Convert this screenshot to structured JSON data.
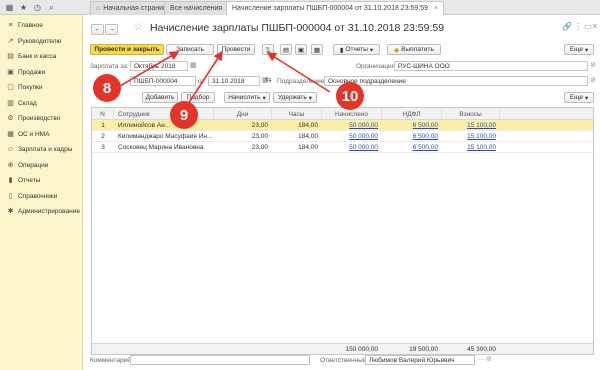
{
  "topbar": {
    "tabs": [
      {
        "label": "Начальная страница"
      },
      {
        "label": "Все начисления"
      },
      {
        "label": "Начисление зарплаты ПШБП-000004 от 31.10.2018 23:59:59"
      }
    ],
    "close_glyph": "×"
  },
  "sidebar": {
    "items": [
      {
        "label": "Главное",
        "icon": "home-icon"
      },
      {
        "label": "Руководителю",
        "icon": "chart-icon"
      },
      {
        "label": "Банк и касса",
        "icon": "bank-icon"
      },
      {
        "label": "Продажи",
        "icon": "sales-icon"
      },
      {
        "label": "Покупки",
        "icon": "cart-icon"
      },
      {
        "label": "Склад",
        "icon": "warehouse-icon"
      },
      {
        "label": "Производство",
        "icon": "factory-icon"
      },
      {
        "label": "ОС и НМА",
        "icon": "assets-icon"
      },
      {
        "label": "Зарплата и кадры",
        "icon": "people-icon"
      },
      {
        "label": "Операции",
        "icon": "operations-icon"
      },
      {
        "label": "Отчеты",
        "icon": "reports-icon"
      },
      {
        "label": "Справочники",
        "icon": "books-icon"
      },
      {
        "label": "Администрирование",
        "icon": "gear-icon"
      }
    ]
  },
  "document": {
    "title": "Начисление зарплаты ПШБП-000004 от 31.10.2018 23:59:59",
    "toolbar": {
      "post_close": "Провести и закрыть",
      "save": "Записать",
      "post": "Провести",
      "reports": "Отчеты",
      "pay": "Выплатить",
      "more": "Еще"
    },
    "fields": {
      "month_label": "Зарплата за:",
      "month_value": "Октябрь 2018",
      "number_value": "ПШБП-000004",
      "date_label": "от:",
      "date_value": "31.10.2018",
      "org_label": "Организация:",
      "org_value": "РУС-ШИНА ООО",
      "dept_label": "Подразделение:",
      "dept_value": "Основное подразделение"
    },
    "table_toolbar": {
      "add": "Добавить",
      "select": "Подбор",
      "accrue": "Начислить",
      "withhold": "Удержать",
      "more": "Еще"
    },
    "table": {
      "columns": [
        "N",
        "Сотрудник",
        "Дни",
        "Часы",
        "Начислено",
        "НДФЛ",
        "Взносы"
      ],
      "rows": [
        {
          "n": "1",
          "employee": "Иллинойсов Ан...",
          "days": "23,00",
          "hours": "184,00",
          "accrued": "50 000,00",
          "ndfl": "6 500,00",
          "contrib": "15 100,00"
        },
        {
          "n": "2",
          "employee": "Килиманджаро Масуфаия Ин...",
          "days": "23,00",
          "hours": "184,00",
          "accrued": "50 000,00",
          "ndfl": "6 500,00",
          "contrib": "15 100,00"
        },
        {
          "n": "3",
          "employee": "Сосковец Марина Ивановна",
          "days": "23,00",
          "hours": "184,00",
          "accrued": "50 000,00",
          "ndfl": "6 500,00",
          "contrib": "15 100,00"
        }
      ],
      "totals": {
        "accrued": "150 000,00",
        "ndfl": "19 500,00",
        "contrib": "45 300,00"
      }
    },
    "footer": {
      "comment_label": "Комментарий:",
      "responsible_label": "Ответственный:",
      "responsible_value": "Любимов Валерий Юрьевич"
    }
  },
  "callouts": [
    "8",
    "9",
    "10"
  ],
  "colors": {
    "accent_yellow": "#f7d94c",
    "sidebar_bg": "#fbf6c9",
    "callout_red": "#e3342a",
    "link_blue": "#2a4fb0"
  }
}
